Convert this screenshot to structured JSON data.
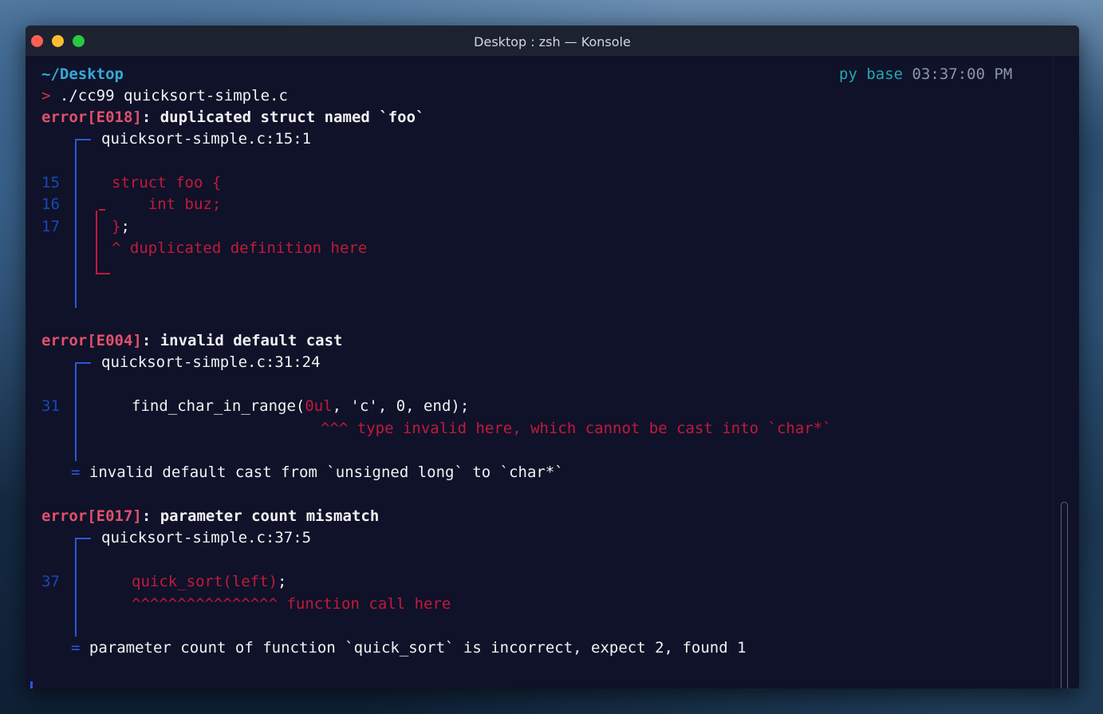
{
  "window": {
    "title": "Desktop : zsh — Konsole"
  },
  "prompt": {
    "cwd": "~/Desktop",
    "arrow": ">",
    "command": "./cc99 quicksort-simple.c",
    "env": "py base",
    "time": "03:37:00 PM"
  },
  "errors": [
    {
      "code": "error[E018]",
      "message": ": duplicated struct named `foo`",
      "location": "quicksort-simple.c:15:1",
      "lines": [
        {
          "num": "15",
          "text": "struct foo {"
        },
        {
          "num": "16",
          "text": "    int buz;"
        },
        {
          "num": "17",
          "text": "}",
          "tail": ";"
        }
      ],
      "annotation": "^ duplicated definition here"
    },
    {
      "code": "error[E004]",
      "message": ": invalid default cast",
      "location": "quicksort-simple.c:31:24",
      "lines": [
        {
          "num": "31",
          "pre": "find_char_in_range(",
          "highlight": "0ul",
          "post": ", 'c', 0, end);"
        }
      ],
      "annotation": "^^^ type invalid here, which cannot be cast into `char*`",
      "note_marker": "=",
      "note": "invalid default cast from `unsigned long` to `char*`"
    },
    {
      "code": "error[E017]",
      "message": ": parameter count mismatch",
      "location": "quicksort-simple.c:37:5",
      "lines": [
        {
          "num": "37",
          "highlight": "quick_sort(left)",
          "post": ";"
        }
      ],
      "annotation": "^^^^^^^^^^^^^^^^ function call here",
      "note_marker": "=",
      "note": "parameter count of function `quick_sort` is incorrect, expect 2, found 1"
    }
  ],
  "colors": {
    "terminal_bg": "#0f1229",
    "error": "#e2506b",
    "highlight_red": "#c21a3a",
    "gutter_blue": "#2a58d9",
    "cwd_cyan": "#36a9d6"
  }
}
